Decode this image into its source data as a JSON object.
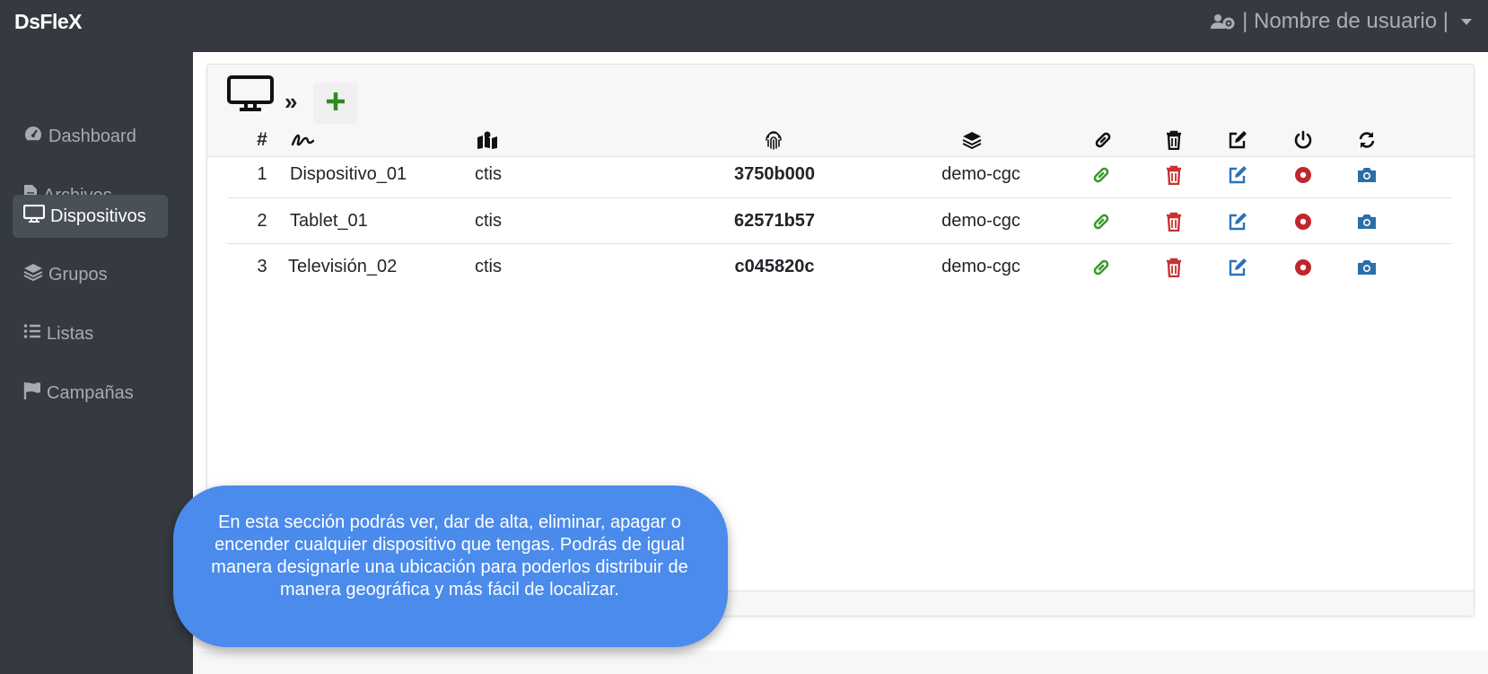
{
  "app": {
    "brand": "DsFleX"
  },
  "user": {
    "label": "| Nombre de usuario |",
    "icon": "users-cog-icon"
  },
  "sidebar": {
    "items": [
      {
        "label": "Dashboard",
        "icon": "tachometer-icon",
        "active": false
      },
      {
        "label": "Archivos",
        "icon": "file-icon",
        "active": false
      },
      {
        "label": "Dispositivos",
        "icon": "desktop-icon",
        "active": true
      },
      {
        "label": "Grupos",
        "icon": "layers-icon",
        "active": false
      },
      {
        "label": "Listas",
        "icon": "list-icon",
        "active": false
      },
      {
        "label": "Campañas",
        "icon": "flag-icon",
        "active": false
      }
    ]
  },
  "page": {
    "breadcrumb_separator": "»",
    "header_icon": "desktop-icon",
    "add_icon": "plus-icon"
  },
  "table": {
    "columns": [
      {
        "key": "index",
        "label": "#"
      },
      {
        "key": "name",
        "icon": "signature-icon"
      },
      {
        "key": "location",
        "icon": "map-marked-icon"
      },
      {
        "key": "id",
        "icon": "fingerprint-icon"
      },
      {
        "key": "group",
        "icon": "layers-icon"
      },
      {
        "key": "link",
        "icon": "link-icon"
      },
      {
        "key": "delete",
        "icon": "trash-icon"
      },
      {
        "key": "edit",
        "icon": "edit-icon"
      },
      {
        "key": "power",
        "icon": "power-icon"
      },
      {
        "key": "sync",
        "icon": "sync-icon"
      }
    ],
    "rows": [
      {
        "index": "1",
        "name": "Dispositivo_01",
        "location": "ctis",
        "id": "3750b000",
        "group": "demo-cgc"
      },
      {
        "index": "2",
        "name": "Tablet_01",
        "location": "ctis",
        "id": "62571b57",
        "group": "demo-cgc"
      },
      {
        "index": "3",
        "name": "Televisión_02",
        "location": "ctis",
        "id": "c045820c",
        "group": "demo-cgc"
      }
    ],
    "action_icons": [
      "link-icon",
      "trash-icon",
      "edit-icon",
      "record-icon",
      "camera-icon"
    ]
  },
  "tooltip": {
    "text": "En esta sección podrás ver, dar de alta, eliminar, apagar o encender cualquier dispositivo que tengas. Podrás de igual manera designarle una ubicación para poderlos distribuir de manera geográfica y más fácil de localizar."
  },
  "colors": {
    "sidebar_bg": "#343a40",
    "link_green": "#3a9a2a",
    "delete_red": "#c83333",
    "edit_blue": "#2a73b8",
    "power_red": "#c0262d",
    "camera_blue": "#2b6fa8",
    "bubble_blue": "#4a8bec"
  }
}
